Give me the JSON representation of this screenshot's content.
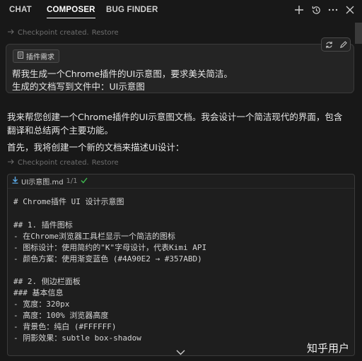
{
  "tabs": [
    {
      "label": "CHAT"
    },
    {
      "label": "COMPOSER"
    },
    {
      "label": "BUG FINDER"
    }
  ],
  "checkpoint": {
    "text": "Checkpoint created.",
    "restore": "Restore"
  },
  "prompt": {
    "chip_label": "插件需求",
    "lines": [
      "帮我生成一个Chrome插件的UI示意图，要求美关简洁。",
      "生成的文档写到文件中：UI示意图"
    ]
  },
  "response": {
    "paragraphs": [
      "我来帮您创建一个Chrome插件的UI示意图文档。我会设计一个简洁现代的界面，包含",
      "翻译和总结两个主要功能。",
      "首先，我将创建一个新的文档来描述UI设计："
    ]
  },
  "code_card": {
    "filename": "UI示意图.md",
    "count": "1/1",
    "lines": [
      "# Chrome插件 UI 设计示意图",
      "",
      "## 1. 插件图标",
      "- 在Chrome浏览器工具栏显示一个简洁的图标",
      "- 图标设计：使用简约的\"K\"字母设计，代表Kimi API",
      "- 颜色方案：使用渐变蓝色 (#4A90E2 → #357ABD)",
      "",
      "## 2. 侧边栏面板",
      "### 基本信息",
      "- 宽度：320px",
      "- 高度：100% 浏览器高度",
      "- 背景色：纯白 (#FFFFFF)",
      "- 阴影效果：subtle box-shadow"
    ]
  },
  "watermark": "知乎用户",
  "icons": [
    "plus-icon",
    "history-icon",
    "more-icon",
    "close-icon",
    "refresh-icon",
    "edit-icon",
    "arrow-right-icon",
    "file-icon",
    "check-icon",
    "chevron-down-icon"
  ],
  "colors": {
    "background": "#181818",
    "panel": "#242424",
    "check": "#3fb950",
    "file_icon": "#5aa9e6"
  }
}
